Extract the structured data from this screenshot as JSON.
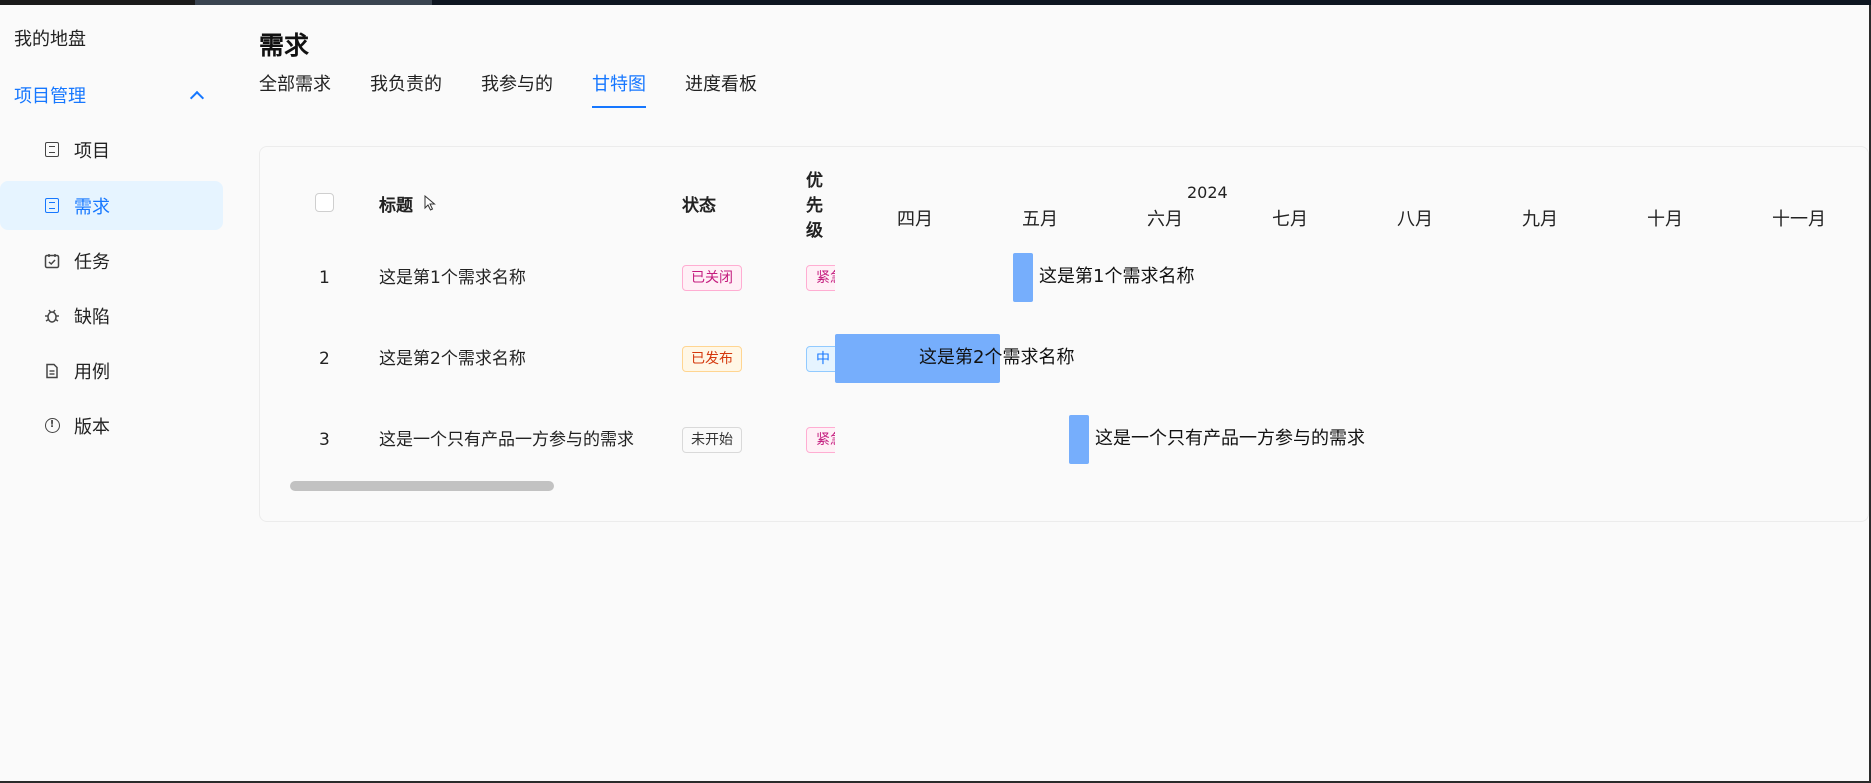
{
  "sidebar": {
    "workspace": "我的地盘",
    "group": "项目管理",
    "items": [
      {
        "label": "项目",
        "icon": "list-icon"
      },
      {
        "label": "需求",
        "icon": "requirement-icon"
      },
      {
        "label": "任务",
        "icon": "task-icon"
      },
      {
        "label": "缺陷",
        "icon": "bug-icon"
      },
      {
        "label": "用例",
        "icon": "document-icon"
      },
      {
        "label": "版本",
        "icon": "info-icon"
      }
    ],
    "active_item": "需求"
  },
  "header": {
    "title": "需求",
    "tabs": [
      "全部需求",
      "我负责的",
      "我参与的",
      "甘特图",
      "进度看板"
    ],
    "active_tab": "甘特图"
  },
  "table": {
    "columns": {
      "title": "标题",
      "status": "状态",
      "priority": "优先级"
    },
    "rows": [
      {
        "num": "1",
        "title": "这是第1个需求名称",
        "status": "已关闭",
        "priority": "紧急"
      },
      {
        "num": "2",
        "title": "这是第2个需求名称",
        "status": "已发布",
        "priority": "中"
      },
      {
        "num": "3",
        "title": "这是一个只有产品一方参与的需求",
        "status": "未开始",
        "priority": "紧急"
      }
    ]
  },
  "gantt": {
    "year": "2024",
    "months": [
      "四月",
      "五月",
      "六月",
      "七月",
      "八月",
      "九月",
      "十月",
      "十一月"
    ],
    "bars": [
      {
        "label": "这是第1个需求名称"
      },
      {
        "label": "这是第2个需求名称"
      },
      {
        "label": "这是一个只有产品一方参与的需求"
      }
    ]
  },
  "colors": {
    "accent": "#1677ff",
    "bar": "#76aefc",
    "active_nav_bg": "#e6f4ff"
  }
}
